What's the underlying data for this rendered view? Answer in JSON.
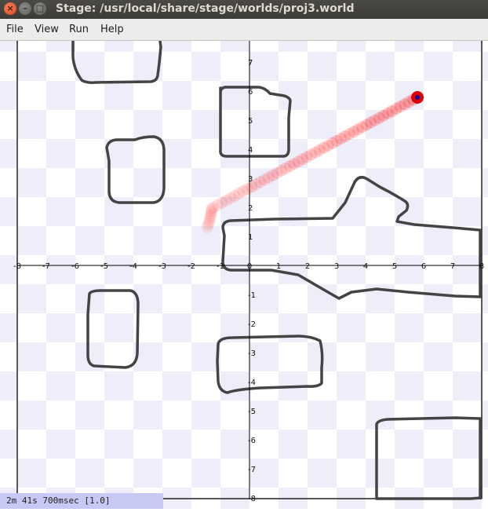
{
  "window": {
    "title": "Stage: /usr/local/share/stage/worlds/proj3.world",
    "close_glyph": "×",
    "minimize_glyph": "–",
    "maximize_glyph": "□"
  },
  "menu": {
    "items": [
      {
        "label": "File"
      },
      {
        "label": "View"
      },
      {
        "label": "Run"
      },
      {
        "label": "Help"
      }
    ]
  },
  "world": {
    "x_ticks": [
      "-8",
      "-7",
      "-6",
      "-5",
      "-4",
      "-3",
      "-2",
      "-1",
      "0",
      "1",
      "2",
      "3",
      "4",
      "5",
      "6",
      "7",
      "8"
    ],
    "y_ticks": [
      "7",
      "6",
      "5",
      "4",
      "3",
      "2",
      "1",
      "-1",
      "-2",
      "-3",
      "-4",
      "-5",
      "-6",
      "-7",
      "-8"
    ],
    "colors": {
      "checker_light": "#ffffff",
      "checker_dark": "#eeeefb",
      "obstacle": "#444444",
      "trail": "#ff2020",
      "robot_body": "#e00000",
      "robot_center": "#1010a0"
    }
  },
  "status": {
    "text": "2m 41s 700msec [1.0]"
  }
}
